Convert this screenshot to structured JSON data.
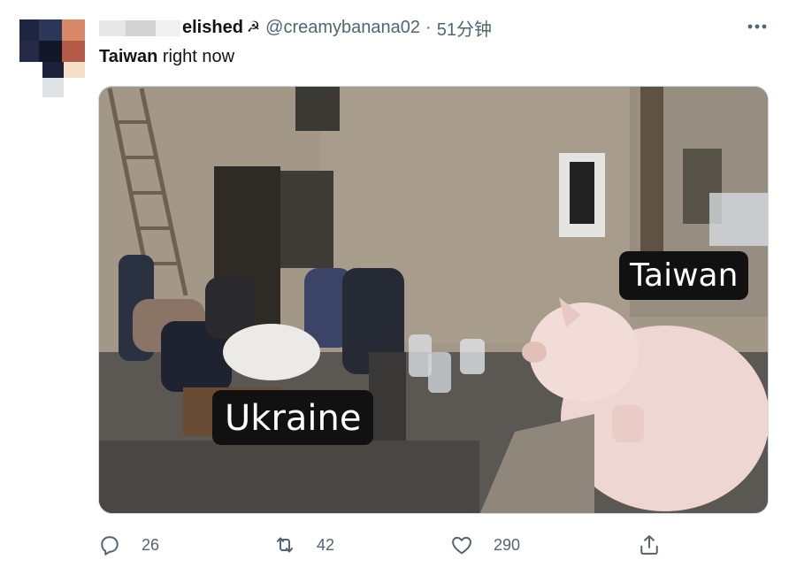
{
  "tweet": {
    "author_display_name": "elished",
    "author_badge": "☭",
    "author_handle": "@creamybanana02",
    "separator": "·",
    "timestamp": "51分钟",
    "text_bold": "Taiwan",
    "text_rest": " right now",
    "more_icon": "more-horizontal-icon"
  },
  "media": {
    "labels": {
      "taiwan": "Taiwan",
      "ukraine": "Ukraine"
    }
  },
  "actions": {
    "reply_count": "26",
    "retweet_count": "42",
    "like_count": "290"
  },
  "colors": {
    "secondary_text": "#536471",
    "primary_text": "#0f1419",
    "border": "#cfd9de"
  }
}
